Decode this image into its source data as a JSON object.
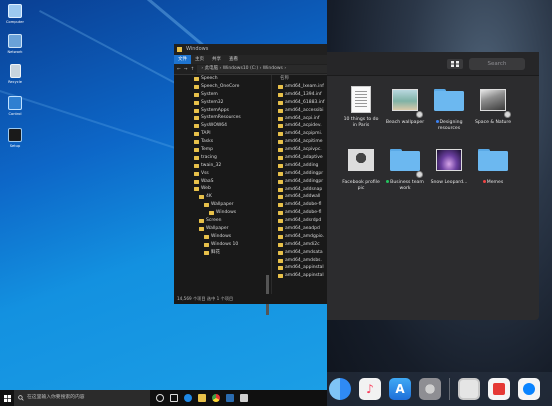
{
  "windows": {
    "desktop_icons": [
      {
        "label": "Computer"
      },
      {
        "label": "Network"
      },
      {
        "label": "Recycle"
      },
      {
        "label": "Control"
      },
      {
        "label": "Setup"
      }
    ],
    "explorer": {
      "title": "Windows",
      "ribbon_tabs": [
        "文件",
        "主页",
        "共享",
        "查看"
      ],
      "path": "› 此电脑 › Windows10 (C:) › Windows ›",
      "nav_items": [
        {
          "label": "Speech",
          "indent": 0
        },
        {
          "label": "Speech_OneCore",
          "indent": 0
        },
        {
          "label": "System",
          "indent": 0
        },
        {
          "label": "System32",
          "indent": 0
        },
        {
          "label": "SystemApps",
          "indent": 0
        },
        {
          "label": "SystemResources",
          "indent": 0
        },
        {
          "label": "SysWOW64",
          "indent": 0
        },
        {
          "label": "TAPI",
          "indent": 0
        },
        {
          "label": "Tasks",
          "indent": 0
        },
        {
          "label": "Temp",
          "indent": 0
        },
        {
          "label": "tracing",
          "indent": 0
        },
        {
          "label": "twain_32",
          "indent": 0
        },
        {
          "label": "Vss",
          "indent": 0
        },
        {
          "label": "WaaS",
          "indent": 0
        },
        {
          "label": "Web",
          "indent": 0
        },
        {
          "label": "4K",
          "indent": 1
        },
        {
          "label": "Wallpaper",
          "indent": 2
        },
        {
          "label": "Windows",
          "indent": 3
        },
        {
          "label": "Screen",
          "indent": 1
        },
        {
          "label": "Wallpaper",
          "indent": 1
        },
        {
          "label": "Windows",
          "indent": 2
        },
        {
          "label": "Windows 10",
          "indent": 2
        },
        {
          "label": "鲜花",
          "indent": 2
        }
      ],
      "file_column_header": "名称",
      "files": [
        "amd64_lxeam.inf",
        "amd64_1394.inf",
        "amd64_61883.inf",
        "amd64_accessibi",
        "amd64_acpi.inf",
        "amd64_acpidev.",
        "amd64_acpipmi.",
        "amd64_acpitime",
        "amd64_acpivpc.",
        "amd64_adaptive",
        "amd64_adding",
        "amd64_addingpr",
        "amd64_addingpr",
        "amd64_addsnap",
        "amd64_addwall",
        "amd64_adobe-fl",
        "amd64_adobe-fl",
        "amd64_adsrdpd",
        "amd64_aeadpd",
        "amd64_amdgpio.",
        "amd64_amdi2c",
        "amd64_amdsata",
        "amd64_amdsbs.",
        "amd64_appinstal",
        "amd64_appinstal"
      ],
      "status": "14,569 个项目    选中 1 个项目"
    },
    "taskbar": {
      "search_placeholder": "在这里输入你要搜索的内容"
    }
  },
  "mac": {
    "search_placeholder": "Search",
    "tiles": [
      {
        "label": "10 things to do in Paris",
        "kind": "doc"
      },
      {
        "label": "Beach wallpaper",
        "kind": "photo-beach"
      },
      {
        "label": "Designing resources",
        "kind": "folder",
        "tag_color": "#3b82f6"
      },
      {
        "label": "Space & Nature",
        "kind": "photo-space"
      },
      {
        "label": "Facebook profile pic",
        "kind": "photo-face"
      },
      {
        "label": "Business team work",
        "kind": "folder",
        "tag_color": "#22c55e"
      },
      {
        "label": "Snow Leopard...",
        "kind": "photo-leopard"
      },
      {
        "label": "Memes",
        "kind": "folder",
        "tag_color": "#ef4444"
      }
    ],
    "dock_apps": [
      {
        "icon": "finder-icon",
        "color": "#4aa8f0"
      },
      {
        "icon": "music-icon",
        "color": "#f2f2f2"
      },
      {
        "icon": "app-store-icon",
        "color": "#2f8af5"
      },
      {
        "icon": "system-preferences-icon",
        "color": "#8e8e93"
      },
      {
        "icon": "preview-icon",
        "color": "#e5e5e5"
      },
      {
        "icon": "news-icon",
        "color": "#f5f5f5"
      },
      {
        "icon": "messenger-icon",
        "color": "#f5f5f5"
      }
    ]
  }
}
